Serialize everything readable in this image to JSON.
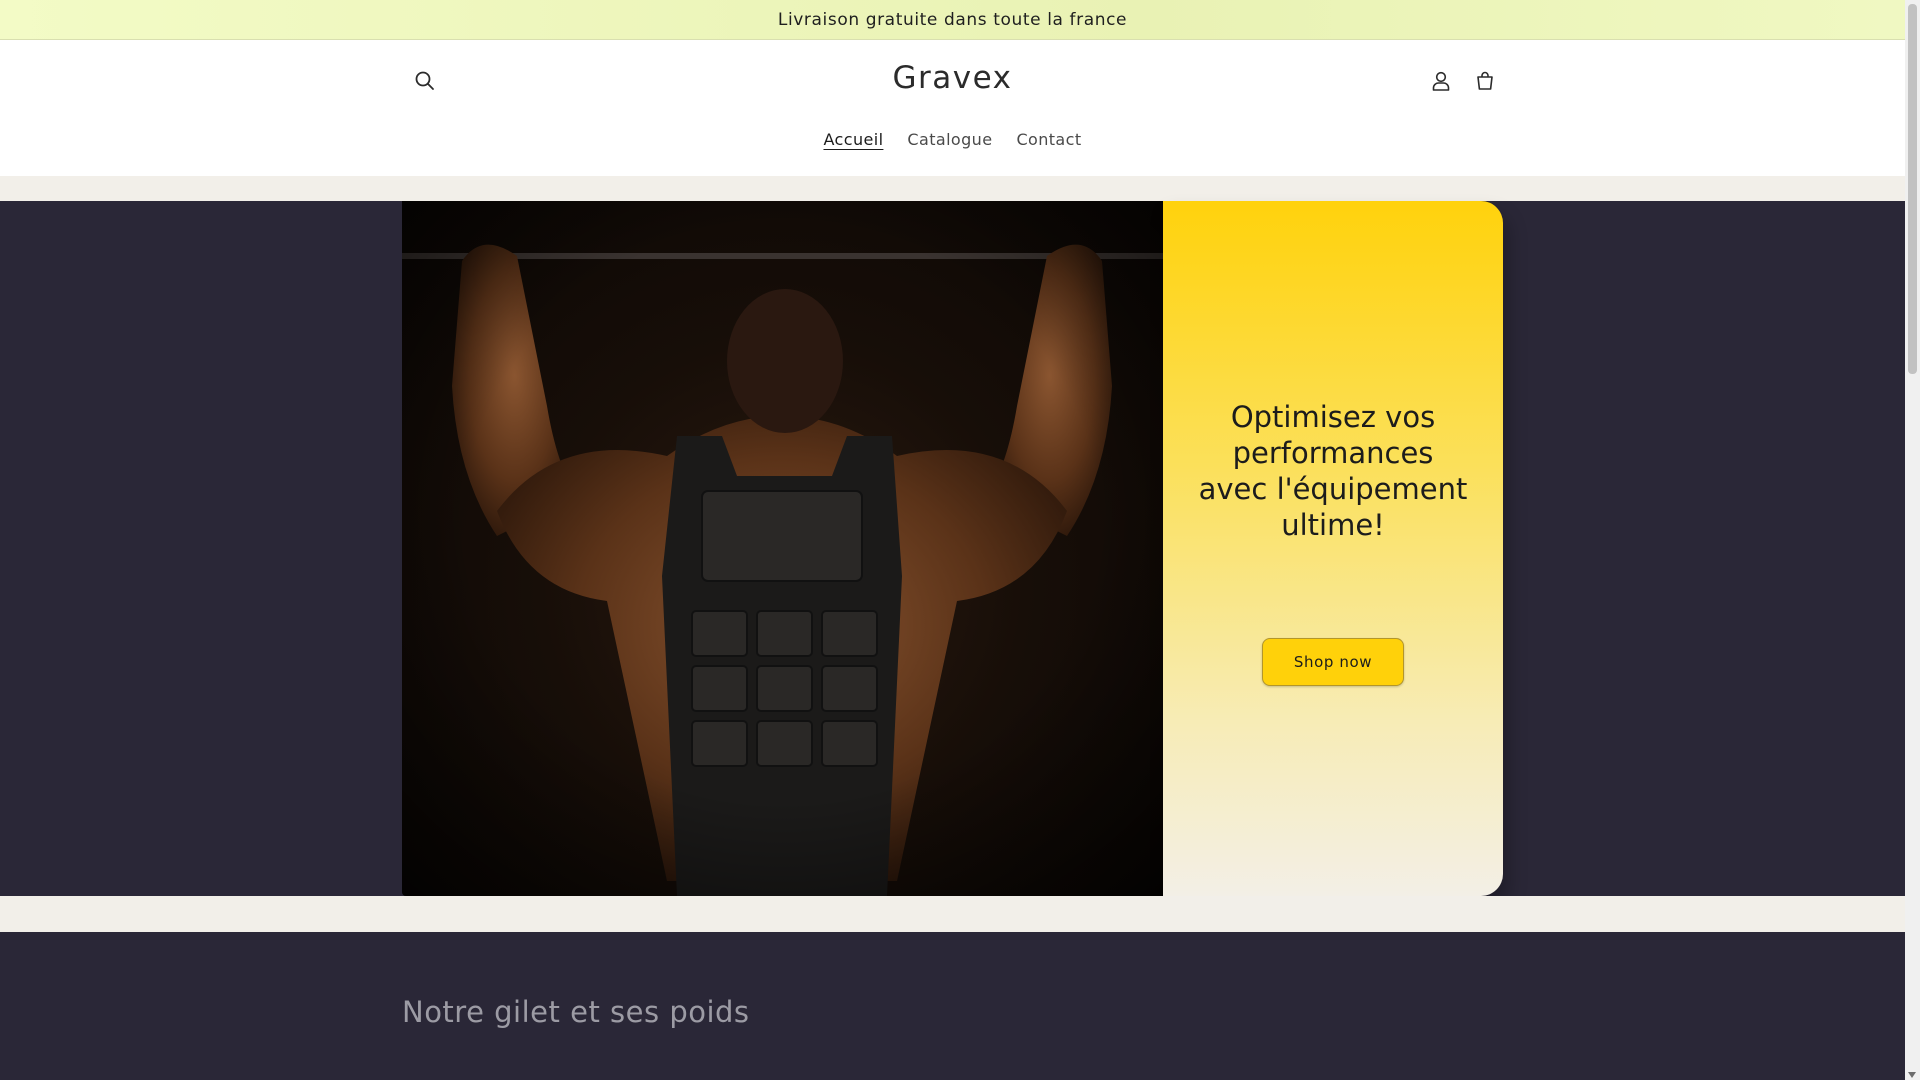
{
  "announcement": {
    "text": "Livraison gratuite dans toute la france"
  },
  "header": {
    "logo": "Gravex",
    "search_icon": "search-icon",
    "account_icon": "user-icon",
    "cart_icon": "cart-icon"
  },
  "nav": {
    "items": [
      {
        "label": "Accueil",
        "active": true
      },
      {
        "label": "Catalogue",
        "active": false
      },
      {
        "label": "Contact",
        "active": false
      }
    ]
  },
  "hero": {
    "heading": "Optimisez vos performances avec l'équipement ultime!",
    "cta_label": "Shop now"
  },
  "section": {
    "title": "Notre gilet et ses poids"
  },
  "colors": {
    "announcement_bg": "#eef6c0",
    "accent_yellow": "#ffd20c",
    "dark_bg": "#2a2737",
    "cream": "#f2efe9"
  }
}
